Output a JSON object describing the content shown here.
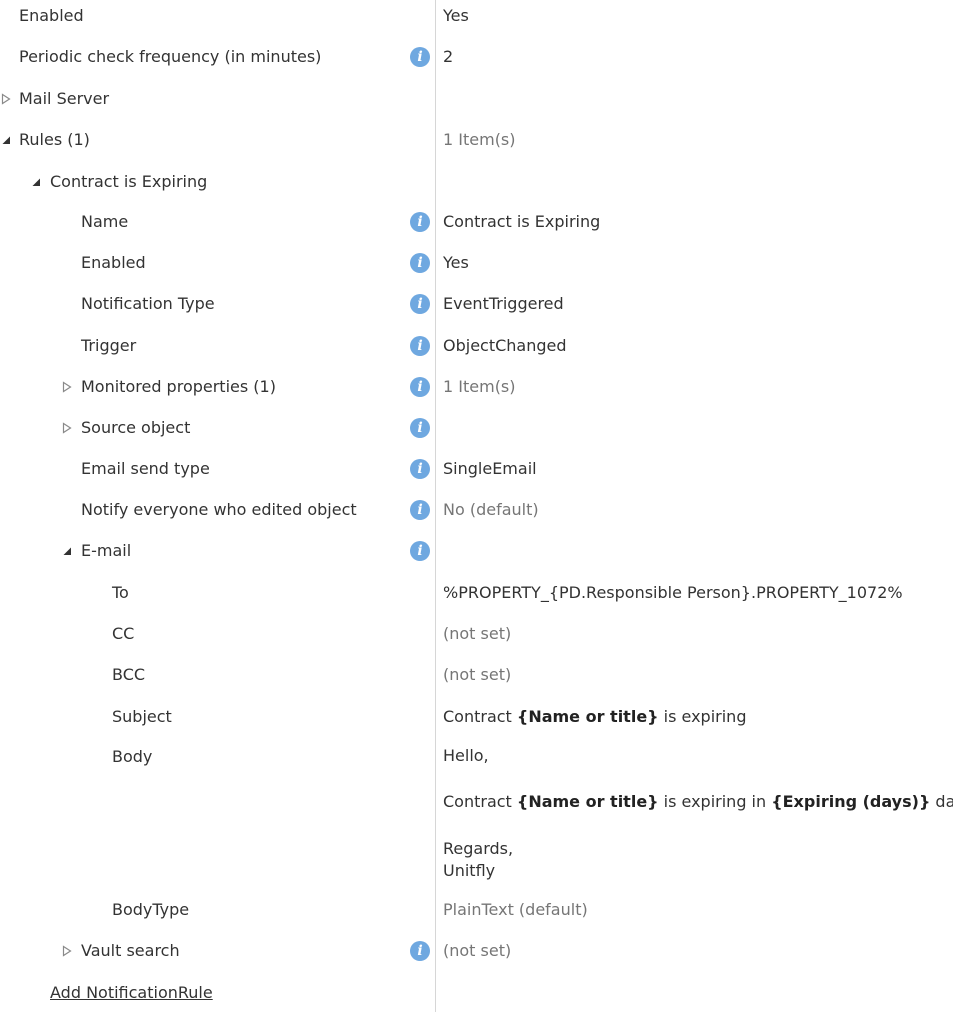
{
  "properties": {
    "enabled": {
      "label": "Enabled",
      "value": "Yes"
    },
    "periodic": {
      "label": "Periodic check frequency (in minutes)",
      "value": "2"
    },
    "mail_server": {
      "label": "Mail Server"
    },
    "rules": {
      "label": "Rules (1)",
      "value": "1 Item(s)"
    },
    "rule": {
      "title": "Contract is Expiring",
      "name": {
        "label": "Name",
        "value": "Contract is Expiring"
      },
      "enabled": {
        "label": "Enabled",
        "value": "Yes"
      },
      "notification_type": {
        "label": "Notification Type",
        "value": "EventTriggered"
      },
      "trigger": {
        "label": "Trigger",
        "value": "ObjectChanged"
      },
      "monitored": {
        "label": "Monitored properties (1)",
        "value": "1 Item(s)"
      },
      "source_object": {
        "label": "Source object"
      },
      "email_send_type": {
        "label": "Email send type",
        "value": "SingleEmail"
      },
      "notify_everyone": {
        "label": "Notify everyone who edited object",
        "value": "No (default)"
      },
      "email": {
        "label": "E-mail",
        "to": {
          "label": "To",
          "value": "%PROPERTY_{PD.Responsible Person}.PROPERTY_1072%"
        },
        "cc": {
          "label": "CC",
          "value": "(not set)"
        },
        "bcc": {
          "label": "BCC",
          "value": "(not set)"
        },
        "subject": {
          "label": "Subject",
          "pre": "Contract ",
          "bold": "{Name or title}",
          "post": " is expiring"
        },
        "body": {
          "label": "Body",
          "line1": "Hello,",
          "line2_pre": "Contract ",
          "line2_bold1": "{Name or title}",
          "line2_mid": " is expiring in ",
          "line2_bold2": "{Expiring (days)}",
          "line2_post": " days.",
          "line3": "Regards,",
          "line4": "Unitfly"
        },
        "body_type": {
          "label": "BodyType",
          "value": "PlainText (default)"
        }
      },
      "vault_search": {
        "label": "Vault search",
        "value": "(not set)"
      }
    },
    "add_rule_link": "Add NotificationRule"
  },
  "icons": {
    "info": "info-icon",
    "collapsed": "triangle-right-icon",
    "expanded": "triangle-down-icon"
  },
  "colors": {
    "info_icon": "#6fa8e0",
    "muted_text": "#767676",
    "divider": "#d6d6d6"
  }
}
